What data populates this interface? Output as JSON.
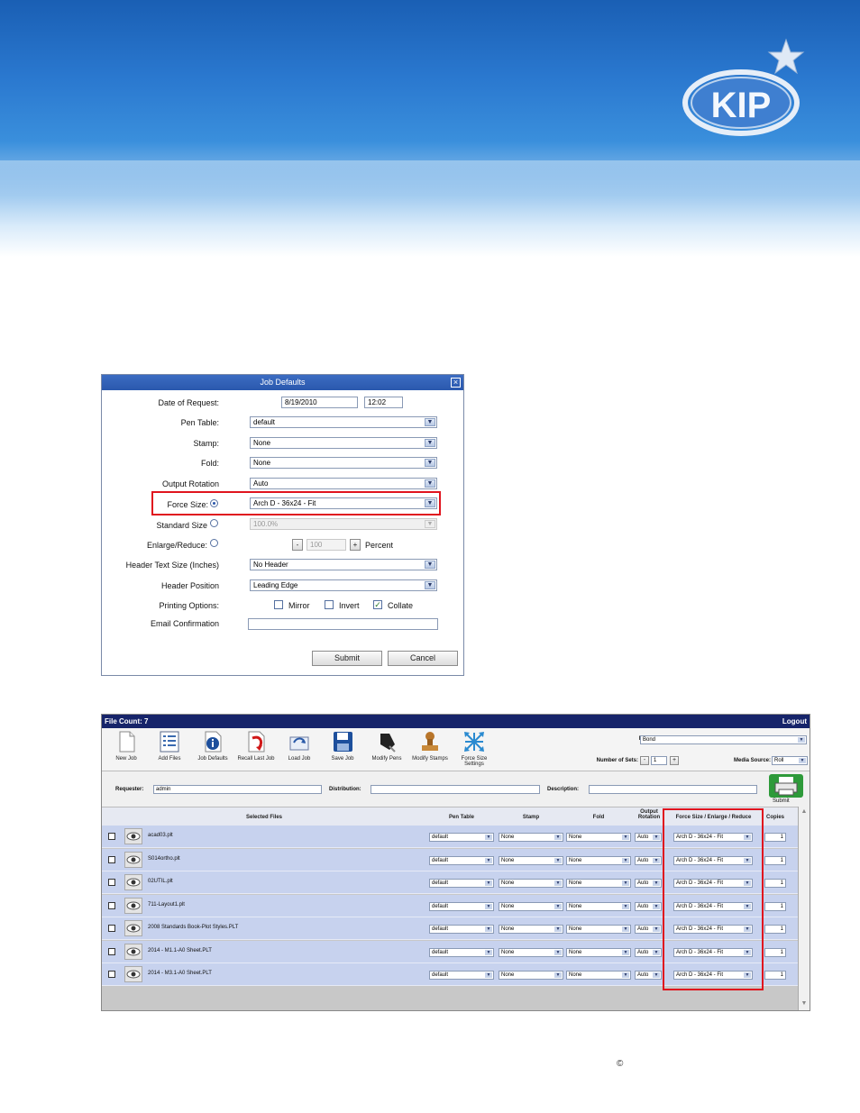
{
  "brand": {
    "logo_text": "KIP"
  },
  "job_defaults": {
    "title": "Job Defaults",
    "close_icon": "close-icon",
    "date_label": "Date of Request:",
    "date_value": "8/19/2010",
    "time_value": "12:02",
    "pen_table_label": "Pen Table:",
    "pen_table_value": "default",
    "stamp_label": "Stamp:",
    "stamp_value": "None",
    "fold_label": "Fold:",
    "fold_value": "None",
    "output_rotation_label": "Output Rotation",
    "output_rotation_value": "Auto",
    "force_size_label": "Force Size:",
    "force_size_value": "Arch D - 36x24 - Fit",
    "standard_size_label": "Standard Size",
    "standard_size_value": "100.0%",
    "enlarge_reduce_label": "Enlarge/Reduce:",
    "enlarge_minus": "-",
    "enlarge_value": "100",
    "enlarge_plus": "+",
    "percent_label": "Percent",
    "header_text_size_label": "Header Text Size (Inches)",
    "header_text_size_value": "No Header",
    "header_position_label": "Header Position",
    "header_position_value": "Leading Edge",
    "printing_options_label": "Printing Options:",
    "mirror_label": "Mirror",
    "invert_label": "Invert",
    "collate_label": "Collate",
    "collate_checked": "✓",
    "email_label": "Email Confirmation",
    "submit_label": "Submit",
    "cancel_label": "Cancel"
  },
  "job_app": {
    "file_count": "File Count: 7",
    "logout": "Logout",
    "toolbar": [
      {
        "label": "New Job",
        "icon": "new-job-icon"
      },
      {
        "label": "Add Files",
        "icon": "add-files-icon"
      },
      {
        "label": "Job Defaults",
        "icon": "info-icon"
      },
      {
        "label": "Recall Last Job",
        "icon": "recall-icon"
      },
      {
        "label": "Load Job",
        "icon": "load-job-icon"
      },
      {
        "label": "Save Job",
        "icon": "save-icon"
      },
      {
        "label": "Modify Pens",
        "icon": "pen-icon"
      },
      {
        "label": "Modify Stamps",
        "icon": "stamp-icon"
      },
      {
        "label": "Force Size Settings",
        "icon": "force-size-icon"
      }
    ],
    "media_type_label": "Media Type:",
    "media_type_value": "Bond",
    "number_of_sets_label": "Number of Sets:",
    "sets_minus": "-",
    "sets_value": "1",
    "sets_plus": "+",
    "media_source_label": "Media Source:",
    "media_source_value": "Roll",
    "requester_label": "Requester:",
    "requester_value": "admin",
    "distribution_label": "Distribution:",
    "description_label": "Description:",
    "submit_label": "Submit",
    "columns": {
      "selected_files": "Selected Files",
      "pen_table": "Pen Table",
      "stamp": "Stamp",
      "fold": "Fold",
      "output_rotation": "Output Rotation",
      "force_size": "Force Size / Enlarge / Reduce",
      "copies": "Copies"
    },
    "rows": [
      {
        "file": "acad03.plt",
        "pen": "default",
        "stamp": "None",
        "fold": "None",
        "rot": "Auto",
        "size": "Arch D - 36x24 - Fit",
        "copies": "1"
      },
      {
        "file": "S014ortho.plt",
        "pen": "default",
        "stamp": "None",
        "fold": "None",
        "rot": "Auto",
        "size": "Arch D - 36x24 - Fit",
        "copies": "1"
      },
      {
        "file": "02UTIL.plt",
        "pen": "default",
        "stamp": "None",
        "fold": "None",
        "rot": "Auto",
        "size": "Arch D - 36x24 - Fit",
        "copies": "1"
      },
      {
        "file": "711-Layout1.plt",
        "pen": "default",
        "stamp": "None",
        "fold": "None",
        "rot": "Auto",
        "size": "Arch D - 36x24 - Fit",
        "copies": "1"
      },
      {
        "file": "2008 Standards Book-Plot Styles.PLT",
        "pen": "default",
        "stamp": "None",
        "fold": "None",
        "rot": "Auto",
        "size": "Arch D - 36x24 - Fit",
        "copies": "1"
      },
      {
        "file": "2014 - M1.1-A0 Sheet.PLT",
        "pen": "default",
        "stamp": "None",
        "fold": "None",
        "rot": "Auto",
        "size": "Arch D - 36x24 - Fit",
        "copies": "1"
      },
      {
        "file": "2014 - M3.1-A0 Sheet.PLT",
        "pen": "default",
        "stamp": "None",
        "fold": "None",
        "rot": "Auto",
        "size": "Arch D - 36x24 - Fit",
        "copies": "1"
      }
    ]
  },
  "footer": {
    "copyright_symbol": "©"
  },
  "colors": {
    "highlight": "#e0141e",
    "titlebar": "#2a58ad",
    "app_header": "#16246a",
    "row": "#c7d2ee"
  }
}
